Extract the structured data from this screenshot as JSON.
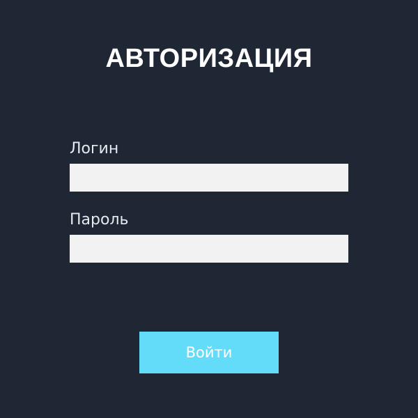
{
  "form": {
    "title": "АВТОРИЗАЦИЯ",
    "login_label": "Логин",
    "login_value": "",
    "password_label": "Пароль",
    "password_value": "",
    "submit_label": "Войти"
  },
  "colors": {
    "background": "#1f2735",
    "input_background": "#f2f2f2",
    "button_background": "#62dcf9",
    "text": "#ffffff"
  }
}
